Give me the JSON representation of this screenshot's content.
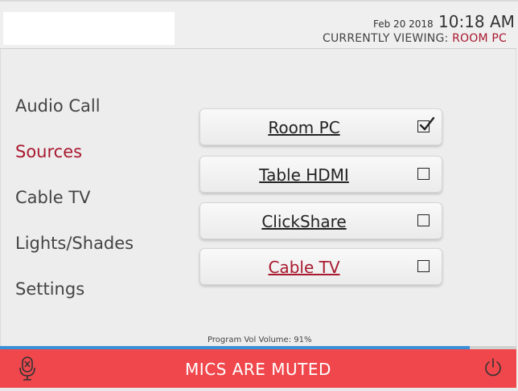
{
  "header": {
    "date": "Feb 20 2018",
    "time": "10:18 AM",
    "viewing_label": "CURRENTLY VIEWING:",
    "viewing_value": "ROOM PC"
  },
  "nav": {
    "items": [
      {
        "label": "Audio Call",
        "active": false
      },
      {
        "label": "Sources",
        "active": true
      },
      {
        "label": "Cable TV",
        "active": false
      },
      {
        "label": "Lights/Shades",
        "active": false
      },
      {
        "label": "Settings",
        "active": false
      }
    ]
  },
  "sources": {
    "items": [
      {
        "label": "Room PC",
        "checked": true
      },
      {
        "label": "Table HDMI",
        "checked": false
      },
      {
        "label": "ClickShare",
        "checked": false
      },
      {
        "label": "Cable TV",
        "checked": false
      }
    ]
  },
  "volume": {
    "label": "Program Vol Volume: 91%",
    "level": 0.91
  },
  "footer": {
    "mute_message": "MICS ARE MUTED",
    "mic_icon": "mic-muted-icon",
    "power_icon": "power-icon"
  },
  "colors": {
    "accent": "#a8182e",
    "mute_bar": "#f0474c",
    "volume_fill": "#3b8fd8"
  }
}
